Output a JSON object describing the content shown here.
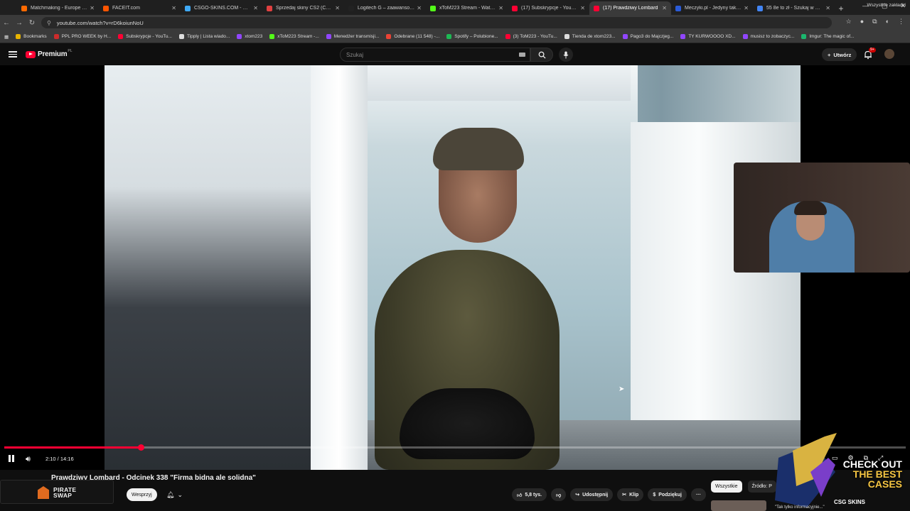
{
  "browser": {
    "tabs": [
      {
        "title": "Matchmaking - Europe 5v5 C",
        "color": "#ff6a00",
        "active": false
      },
      {
        "title": "FACEIT.com",
        "color": "#ff5500",
        "active": false
      },
      {
        "title": "CSGO-SKINS.COM - Najlepsz",
        "color": "#3fa9f5",
        "active": false
      },
      {
        "title": "Sprzedaj skiny CS2 (CSGO) |",
        "color": "#e04040",
        "active": false
      },
      {
        "title": "Logitech G – zaawansowany",
        "color": "#222222",
        "active": false
      },
      {
        "title": "xToM223 Stream - Watch Live",
        "color": "#53fc18",
        "active": false
      },
      {
        "title": "(17) Subskrypcje - YouTube",
        "color": "#ff0033",
        "active": false
      },
      {
        "title": "(17) Prawdziwy Lombard",
        "color": "#ff0033",
        "active": true
      },
      {
        "title": "Meczyki.pl - Jedyny taki portal",
        "color": "#2a5bd7",
        "active": false
      },
      {
        "title": "55 8e to zł - Szukaj w Google",
        "color": "#4285f4",
        "active": false
      }
    ],
    "new_tab_label": "+",
    "url": "youtube.com/watch?v=rD6koiunNoU",
    "bookmarks": [
      {
        "label": "Bookmarks",
        "color": "#e8b400"
      },
      {
        "label": "PPL PRO WEEK by H...",
        "color": "#cc2b2b"
      },
      {
        "label": "Subskrypcje - YouTu...",
        "color": "#ff0033"
      },
      {
        "label": "Tipply | Lista wiado...",
        "color": "#dddddd"
      },
      {
        "label": "xtom223",
        "color": "#9146ff"
      },
      {
        "label": "xToM223 Stream -...",
        "color": "#53fc18"
      },
      {
        "label": "Menedżer transmisji...",
        "color": "#9146ff"
      },
      {
        "label": "Odebrane (11 548) -...",
        "color": "#ea4335"
      },
      {
        "label": "Spotify – Polubione...",
        "color": "#1db954"
      },
      {
        "label": "(3) ToM223 - YouTu...",
        "color": "#ff0033"
      },
      {
        "label": "Tienda de xtom223...",
        "color": "#dddddd"
      },
      {
        "label": "Pago3 do Majczjeg...",
        "color": "#9146ff"
      },
      {
        "label": "TY KURWOOOO XD...",
        "color": "#9146ff"
      },
      {
        "label": "musisz to zobaczyc...",
        "color": "#9146ff"
      },
      {
        "label": "Imgur: The magic of...",
        "color": "#1bb76e"
      }
    ],
    "all_bookmarks_label": "Wszystkie zakładki"
  },
  "youtube": {
    "logo_text": "Premium",
    "logo_region": "PL",
    "search_placeholder": "Szukaj",
    "create_label": "Utwórz",
    "notif_count": "9+"
  },
  "player": {
    "current_time": "2:10",
    "duration": "14:16",
    "time_display": "2:10 / 14:16",
    "progress_fraction": 0.152
  },
  "video": {
    "title": "Prawdziwy Lombard - Odcinek 338 \"Firma bidna ale solidna\"",
    "join_label": "Wesprzyj",
    "likes_label": "5,8 tys.",
    "share_label": "Udostępnij",
    "clip_label": "Klip",
    "thanks_label": "Podziękuj",
    "more_label": "···"
  },
  "ad": {
    "brand_line1": "PIRATE",
    "brand_line2": "SWAP"
  },
  "sidebar_chips": {
    "all": "Wszystkie",
    "source": "Źródło: P"
  },
  "overlay_promo": {
    "line1": "CHECK OUT",
    "line2": "THE BEST",
    "line3": "CASES",
    "brand": "CSG SKINS"
  },
  "related_caption": "\"Tak tylko informacyjnie...\""
}
